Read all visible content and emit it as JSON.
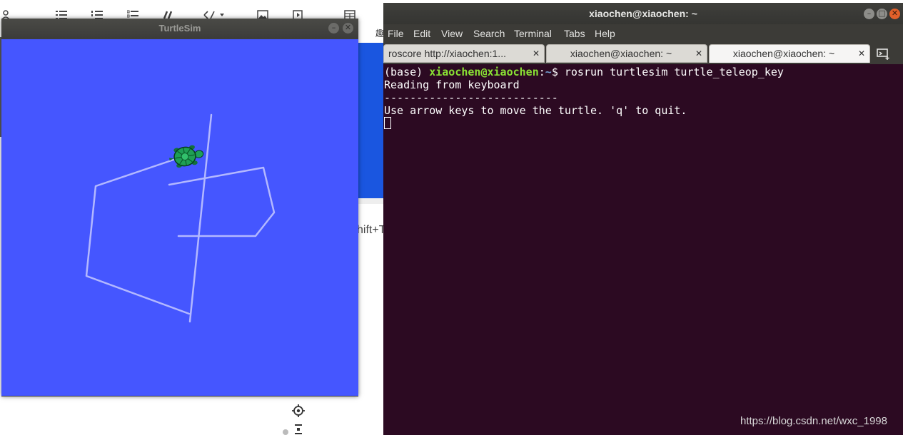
{
  "background_app": {
    "shortcut_fragment": "hift+T",
    "cjk_fragment": "趣"
  },
  "turtlesim": {
    "title": "TurtleSim",
    "minimize_label": "–",
    "close_label": "✕",
    "background_color": "#4556ff",
    "pen_color": "#b3b8ff"
  },
  "terminal": {
    "title": "xiaochen@xiaochen: ~",
    "window_buttons": {
      "minimize": "–",
      "maximize": "□",
      "close": "✕"
    },
    "menu": [
      "File",
      "Edit",
      "View",
      "Search",
      "Terminal",
      "Tabs",
      "Help"
    ],
    "tabs": [
      {
        "label": "roscore http://xiaochen:1...",
        "close": "✕",
        "active": false
      },
      {
        "label": "xiaochen@xiaochen: ~",
        "close": "✕",
        "active": false
      },
      {
        "label": "xiaochen@xiaochen: ~",
        "close": "✕",
        "active": true
      }
    ],
    "prompt": {
      "env": "(base) ",
      "user_host": "xiaochen@xiaochen",
      "sep": ":",
      "path": "~",
      "symbol": "$ ",
      "command": "rosrun turtlesim turtle_teleop_key"
    },
    "output": [
      "Reading from keyboard",
      "---------------------------",
      "Use arrow keys to move the turtle. 'q' to quit."
    ],
    "colors": {
      "background": "#2c0a22",
      "user": "#8ae234",
      "path": "#729fcf"
    }
  },
  "watermark": "https://blog.csdn.net/wxc_1998"
}
